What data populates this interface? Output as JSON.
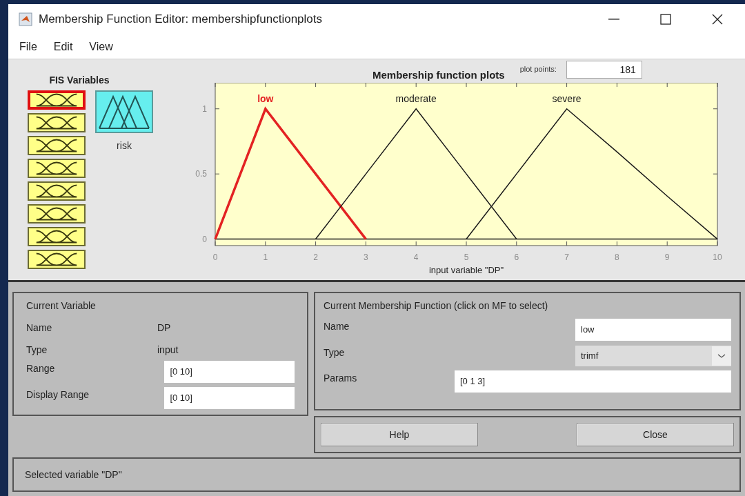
{
  "window": {
    "title": "Membership Function Editor: membershipfunctionplots"
  },
  "menu": [
    "File",
    "Edit",
    "View"
  ],
  "fis_variables": {
    "title": "FIS Variables",
    "inputs": [
      {
        "selected": true
      },
      {
        "selected": false
      },
      {
        "selected": false
      },
      {
        "selected": false
      },
      {
        "selected": false
      },
      {
        "selected": false
      },
      {
        "selected": false
      },
      {
        "selected": false
      }
    ],
    "outputs": [
      {
        "label": "risk",
        "selected": false
      }
    ]
  },
  "plot": {
    "plot_points_label": "plot points:",
    "plot_points": "181",
    "chart_data": {
      "type": "line",
      "title": "Membership function plots",
      "xlabel": "input variable \"DP\"",
      "x": [
        0,
        1,
        2,
        3,
        4,
        5,
        6,
        7,
        8,
        9,
        10
      ],
      "series": [
        {
          "name": "low",
          "color": "#e32222",
          "values": [
            0,
            1,
            0.5,
            0,
            null,
            null,
            null,
            null,
            null,
            null,
            null
          ]
        },
        {
          "name": "moderate",
          "color": "#1a1a1a",
          "values": [
            null,
            null,
            0,
            0.5,
            1,
            0.5,
            0,
            null,
            null,
            null,
            null
          ]
        },
        {
          "name": "severe",
          "color": "#1a1a1a",
          "values": [
            null,
            null,
            null,
            null,
            null,
            0,
            0.5,
            1,
            0.67,
            0.33,
            0
          ]
        }
      ],
      "xlim": [
        0,
        10
      ],
      "ylim": [
        -0.05,
        1.2
      ],
      "xticks": [
        0,
        1,
        2,
        3,
        4,
        5,
        6,
        7,
        8,
        9,
        10
      ],
      "yticks": [
        0,
        0.5,
        1
      ]
    }
  },
  "current_variable": {
    "title": "Current Variable",
    "name_label": "Name",
    "name": "DP",
    "type_label": "Type",
    "type": "input",
    "range_label": "Range",
    "range": "[0 10]",
    "display_range_label": "Display Range",
    "display_range": "[0 10]"
  },
  "current_mf": {
    "title": "Current Membership Function (click on MF to select)",
    "name_label": "Name",
    "name": "low",
    "type_label": "Type",
    "type": "trimf",
    "params_label": "Params",
    "params": "[0 1 3]"
  },
  "buttons": [
    "Help",
    "Close"
  ],
  "status": "Selected variable \"DP\""
}
